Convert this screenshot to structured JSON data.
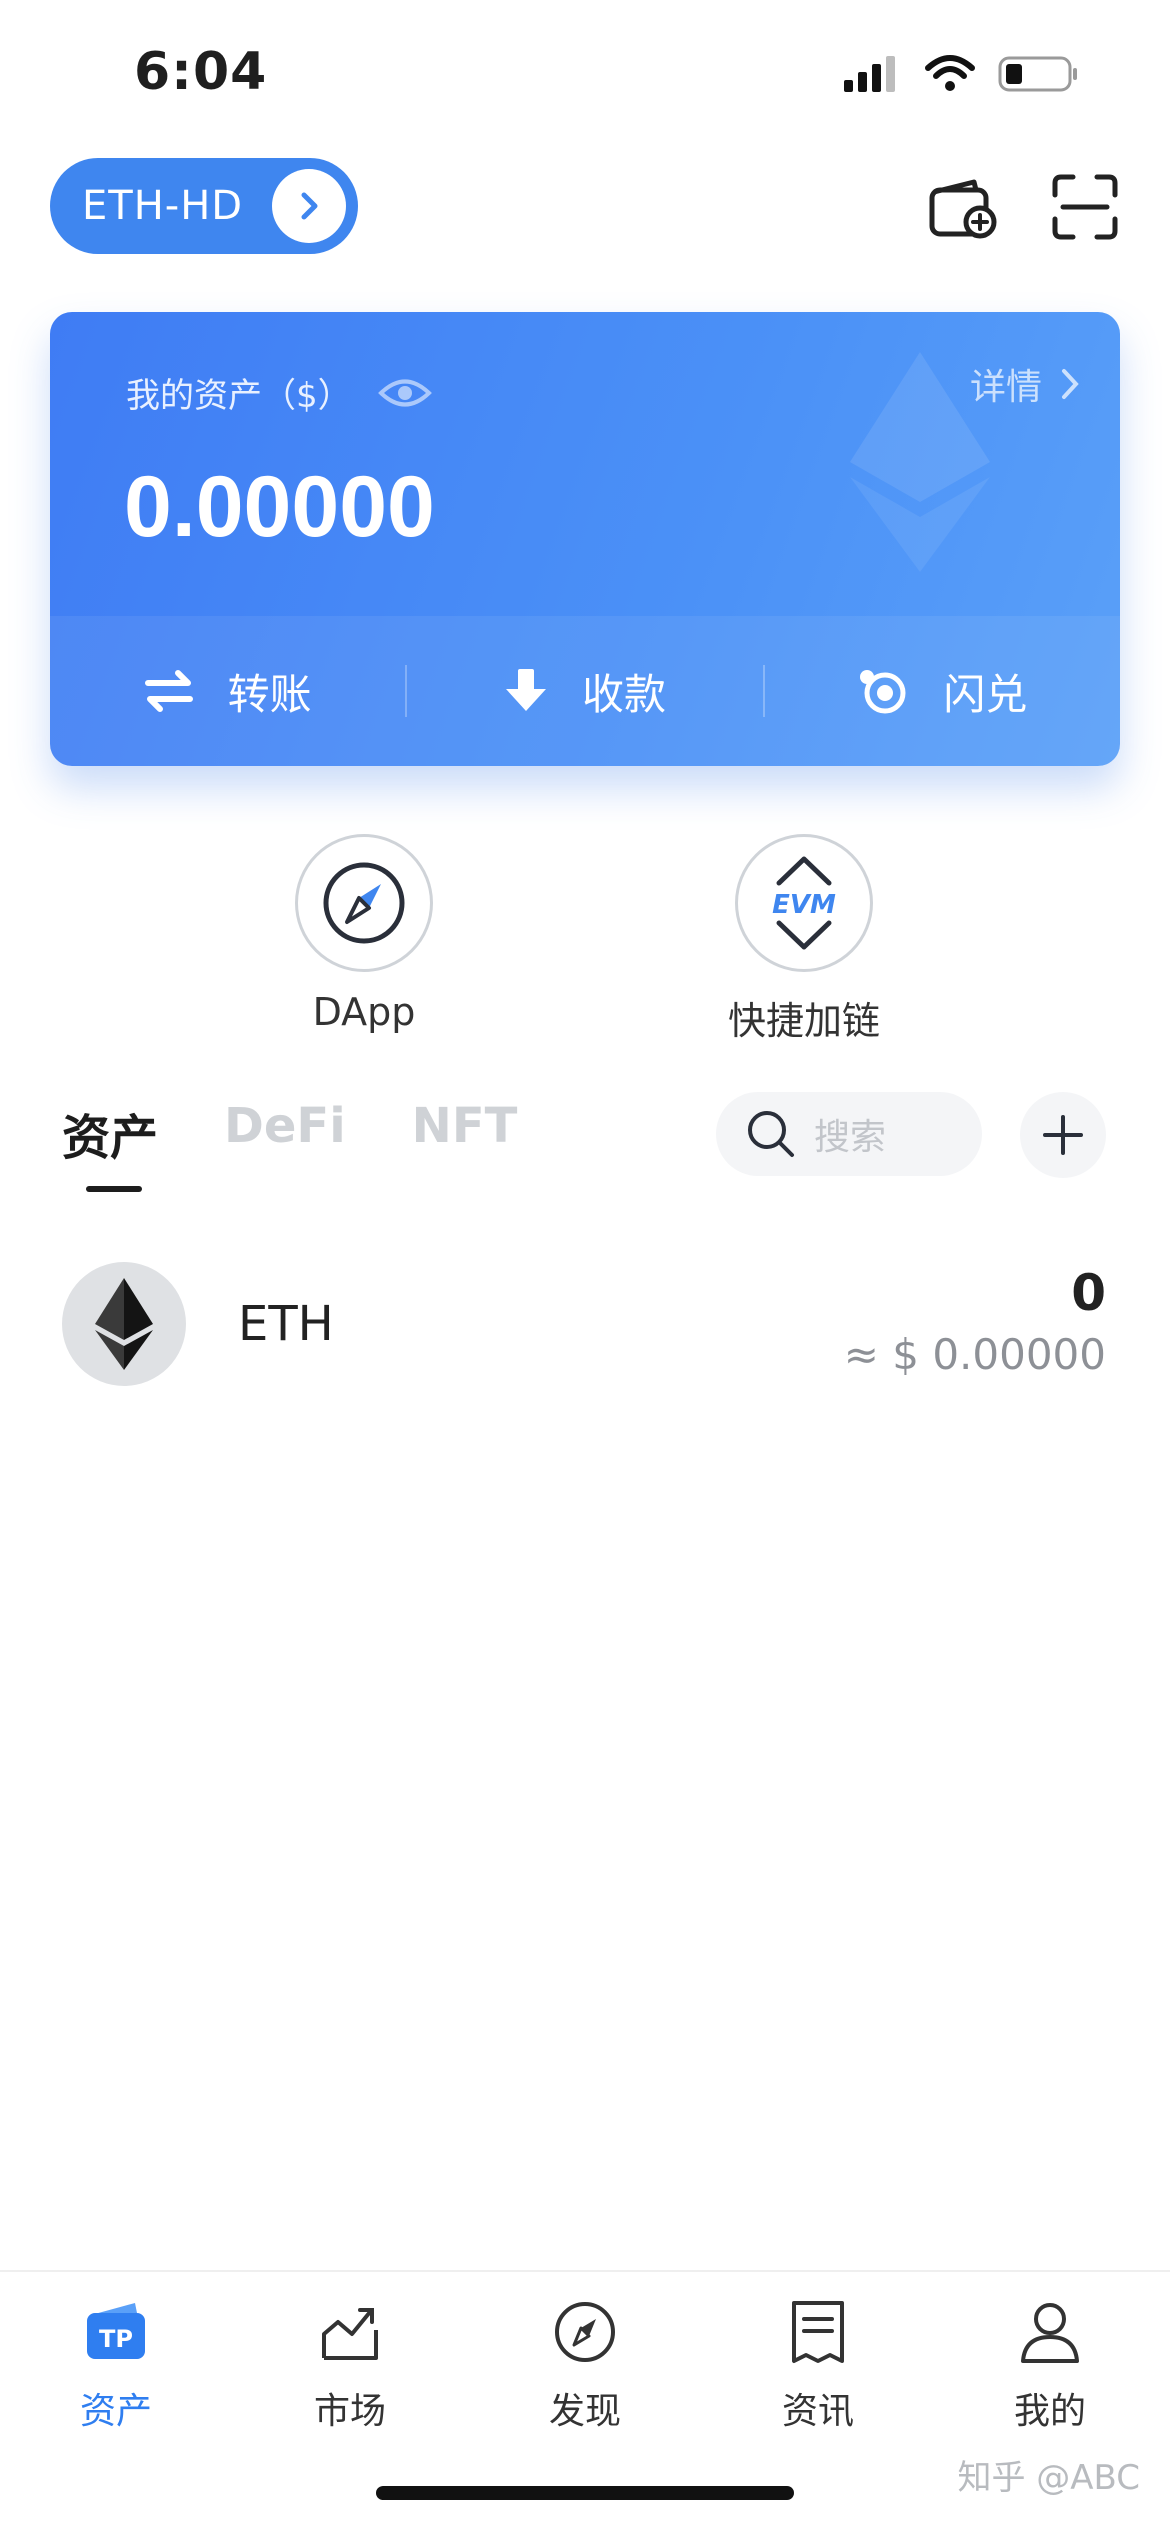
{
  "status_bar": {
    "time": "6:04"
  },
  "header": {
    "wallet_name": "ETH-HD",
    "icons": [
      "wallet-add-icon",
      "scan-icon"
    ]
  },
  "asset_card": {
    "label": "我的资产（$）",
    "value": "0.00000",
    "detail_label": "详情",
    "actions": [
      {
        "label": "转账",
        "icon": "transfer-icon"
      },
      {
        "label": "收款",
        "icon": "receive-icon"
      },
      {
        "label": "闪兑",
        "icon": "swap-icon"
      }
    ],
    "colors": {
      "gradient_start": "#3f7cf4",
      "gradient_end": "#5aa0f8"
    }
  },
  "quick_tools": [
    {
      "label": "DApp",
      "icon": "compass-icon"
    },
    {
      "label": "快捷加链",
      "icon": "evm-icon"
    }
  ],
  "evm_badge": "EVM",
  "tabs": [
    {
      "label": "资产",
      "active": true
    },
    {
      "label": "DeFi",
      "active": false
    },
    {
      "label": "NFT",
      "active": false
    }
  ],
  "search": {
    "placeholder": "搜索"
  },
  "tokens": [
    {
      "symbol": "ETH",
      "balance": "0",
      "fiat": "≈ $ 0.00000"
    }
  ],
  "bottom_nav": [
    {
      "label": "资产",
      "icon": "tp-wallet-icon",
      "active": true
    },
    {
      "label": "市场",
      "icon": "market-chart-icon",
      "active": false
    },
    {
      "label": "发现",
      "icon": "discover-compass-icon",
      "active": false
    },
    {
      "label": "资讯",
      "icon": "news-icon",
      "active": false
    },
    {
      "label": "我的",
      "icon": "profile-icon",
      "active": false
    }
  ],
  "tp_logo_text": "TP",
  "watermark": "知乎 @ABC",
  "accent_color": "#3f86ef"
}
